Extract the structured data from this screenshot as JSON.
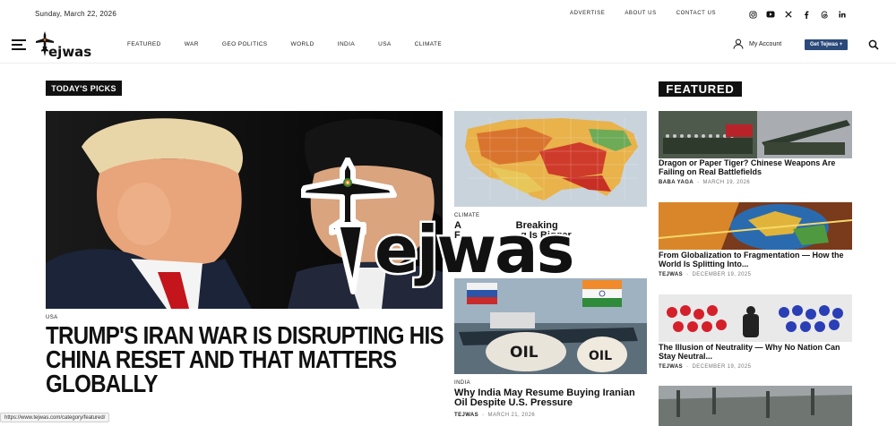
{
  "topbar": {
    "date": "Sunday, March 22, 2026",
    "links": [
      "ADVERTISE",
      "ABOUT US",
      "CONTACT US"
    ],
    "social_icons": [
      "instagram-icon",
      "youtube-icon",
      "x-icon",
      "facebook-icon",
      "threads-icon",
      "linkedin-icon"
    ]
  },
  "nav": {
    "logo_text": "ejwas",
    "items": [
      "FEATURED",
      "WAR",
      "GEO POLITICS",
      "WORLD",
      "INDIA",
      "USA",
      "CLIMATE"
    ],
    "account_label": "My Account",
    "cta_label": "Get Tejwas +"
  },
  "sections": {
    "picks_label": "TODAY'S PICKS",
    "featured_label": "FEATURED"
  },
  "hero": {
    "category": "USA",
    "title": "TRUMP'S IRAN WAR IS DISRUPTING HIS CHINA RESET AND THAT MATTERS GLOBALLY"
  },
  "middle": [
    {
      "category": "CLIMATE",
      "title": "A                    Breaking\nF                      g Is Bigger"
    },
    {
      "category": "INDIA",
      "title": "Why India May Resume Buying Iranian Oil Despite U.S. Pressure",
      "author": "TEJWAS",
      "date": "MARCH 21, 2026",
      "image_text": "OIL"
    }
  ],
  "featured": [
    {
      "title": "Dragon or Paper Tiger? Chinese Weapons Are Failing on Real Battlefields",
      "author": "BABA YAGA",
      "date": "MARCH 19, 2026"
    },
    {
      "title": "From Globalization to Fragmentation — How the World Is Splitting Into...",
      "author": "TEJWAS",
      "date": "DECEMBER 19, 2025"
    },
    {
      "title": "The Illusion of Neutrality — Why No Nation Can Stay Neutral...",
      "author": "TEJWAS",
      "date": "DECEMBER 19, 2025"
    }
  ],
  "watermark_text": "ejwas",
  "statusbar": {
    "url": "https://www.tejwas.com/category/featured/"
  },
  "colors": {
    "accent": "#2b4a7a",
    "tag_bg": "#111111"
  }
}
